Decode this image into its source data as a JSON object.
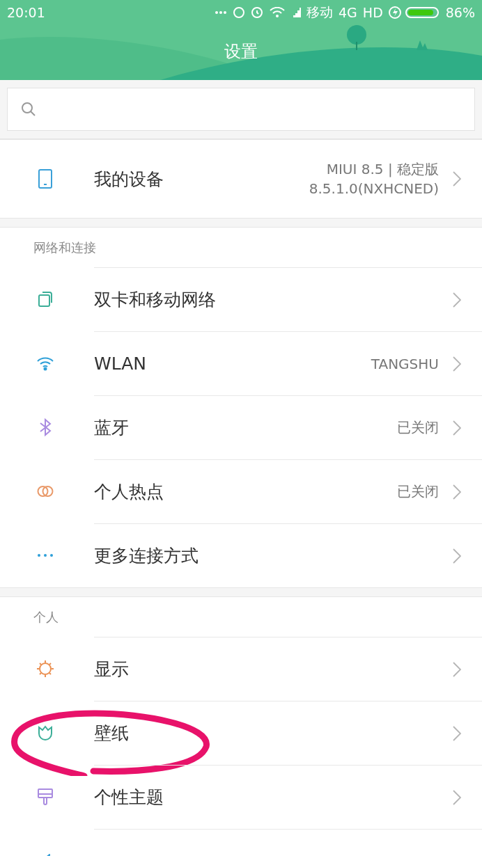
{
  "status_bar": {
    "time": "20:01",
    "carrier": "移动",
    "network": "4G",
    "hd": "HD",
    "battery": "86%"
  },
  "header": {
    "title": "设置"
  },
  "device": {
    "kind": "phone",
    "label": "我的设备",
    "value_lines": [
      "MIUI 8.5 | 稳定版",
      "8.5.1.0(NXHCNED)"
    ]
  },
  "sections": [
    {
      "title": "网络和连接",
      "items": [
        {
          "kind": "sim",
          "label": "双卡和移动网络",
          "circled": false
        },
        {
          "kind": "wifi",
          "label": "WLAN",
          "value": "TANGSHU",
          "circled": false
        },
        {
          "kind": "bluetooth",
          "label": "蓝牙",
          "value": "已关闭",
          "circled": false
        },
        {
          "kind": "hotspot",
          "label": "个人热点",
          "value": "已关闭",
          "circled": false
        },
        {
          "kind": "more",
          "label": "更多连接方式",
          "circled": false
        }
      ]
    },
    {
      "title": "个人",
      "items": [
        {
          "kind": "display",
          "label": "显示",
          "circled": false
        },
        {
          "kind": "wallpaper",
          "label": "壁纸",
          "circled": true
        },
        {
          "kind": "theme",
          "label": "个性主题",
          "circled": false
        },
        {
          "kind": "sound",
          "circled": false
        }
      ]
    }
  ]
}
